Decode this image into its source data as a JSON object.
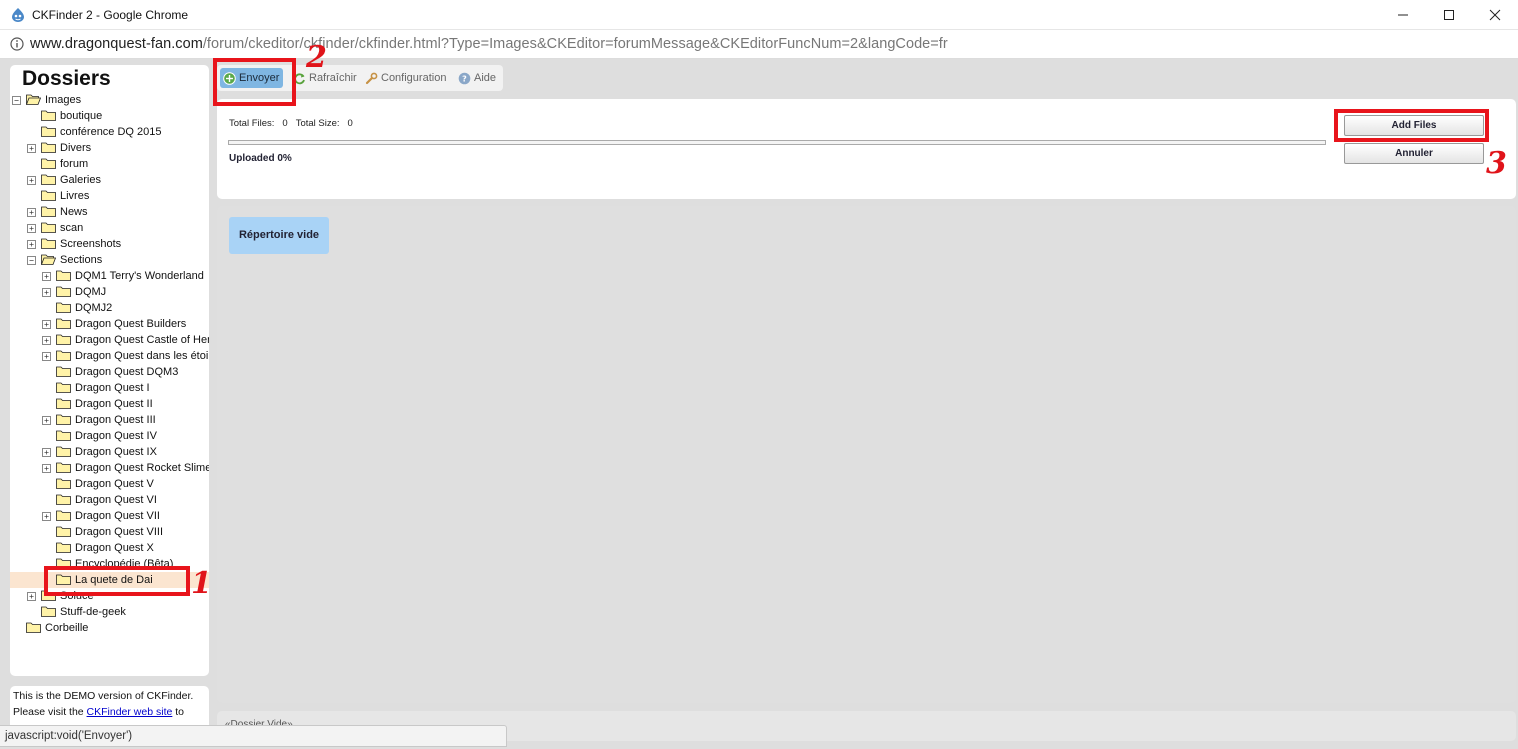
{
  "window": {
    "title": "CKFinder 2 - Google Chrome",
    "url_host": "www.dragonquest-fan.com",
    "url_rest": "/forum/ckeditor/ckfinder/ckfinder.html?Type=Images&CKEditor=forumMessage&CKEditorFuncNum=2&langCode=fr"
  },
  "sidebar": {
    "title": "Dossiers",
    "tree": [
      {
        "label": "Images",
        "level": 0,
        "expander": "−",
        "open": true
      },
      {
        "label": "boutique",
        "level": 1,
        "expander": ""
      },
      {
        "label": "conférence DQ 2015",
        "level": 1,
        "expander": ""
      },
      {
        "label": "Divers",
        "level": 1,
        "expander": "+"
      },
      {
        "label": "forum",
        "level": 1,
        "expander": ""
      },
      {
        "label": "Galeries",
        "level": 1,
        "expander": "+"
      },
      {
        "label": "Livres",
        "level": 1,
        "expander": ""
      },
      {
        "label": "News",
        "level": 1,
        "expander": "+"
      },
      {
        "label": "scan",
        "level": 1,
        "expander": "+"
      },
      {
        "label": "Screenshots",
        "level": 1,
        "expander": "+"
      },
      {
        "label": "Sections",
        "level": 1,
        "expander": "−",
        "open": true
      },
      {
        "label": "DQM1 Terry's Wonderland",
        "level": 2,
        "expander": "+"
      },
      {
        "label": "DQMJ",
        "level": 2,
        "expander": "+"
      },
      {
        "label": "DQMJ2",
        "level": 2,
        "expander": ""
      },
      {
        "label": "Dragon Quest Builders",
        "level": 2,
        "expander": "+"
      },
      {
        "label": "Dragon Quest Castle of Heroes",
        "level": 2,
        "expander": "+"
      },
      {
        "label": "Dragon Quest dans les étoiles",
        "level": 2,
        "expander": "+"
      },
      {
        "label": "Dragon Quest DQM3",
        "level": 2,
        "expander": ""
      },
      {
        "label": "Dragon Quest I",
        "level": 2,
        "expander": ""
      },
      {
        "label": "Dragon Quest II",
        "level": 2,
        "expander": ""
      },
      {
        "label": "Dragon Quest III",
        "level": 2,
        "expander": "+"
      },
      {
        "label": "Dragon Quest IV",
        "level": 2,
        "expander": ""
      },
      {
        "label": "Dragon Quest IX",
        "level": 2,
        "expander": "+"
      },
      {
        "label": "Dragon Quest Rocket Slime",
        "level": 2,
        "expander": "+"
      },
      {
        "label": "Dragon Quest V",
        "level": 2,
        "expander": ""
      },
      {
        "label": "Dragon Quest VI",
        "level": 2,
        "expander": ""
      },
      {
        "label": "Dragon Quest VII",
        "level": 2,
        "expander": "+"
      },
      {
        "label": "Dragon Quest VIII",
        "level": 2,
        "expander": ""
      },
      {
        "label": "Dragon Quest X",
        "level": 2,
        "expander": ""
      },
      {
        "label": "Encyclopédie (Bêta)",
        "level": 2,
        "expander": ""
      },
      {
        "label": "La quete de Dai",
        "level": 2,
        "expander": "",
        "selected": true
      },
      {
        "label": "Soluce",
        "level": 1,
        "expander": "+"
      },
      {
        "label": "Stuff-de-geek",
        "level": 1,
        "expander": ""
      },
      {
        "label": "Corbeille",
        "level": 0,
        "expander": ""
      }
    ],
    "demo_text_1": "This is the DEMO version of CKFinder.",
    "demo_text_2": "Please visit the ",
    "demo_link": "CKFinder web site",
    "demo_text_3": " to"
  },
  "toolbar": {
    "upload": "Envoyer",
    "refresh": "Rafraîchir",
    "settings": "Configuration",
    "help": "Aide"
  },
  "upload_panel": {
    "total_files_label": "Total Files:",
    "total_files_value": "0",
    "total_size_label": "Total Size:",
    "total_size_value": "0",
    "progress": 0,
    "uploaded_text": "Uploaded 0%",
    "add_files": "Add Files",
    "cancel": "Annuler"
  },
  "files": {
    "empty_message": "Répertoire vide"
  },
  "statusbar": {
    "text": "«Dossier Vide»"
  },
  "browser_status": "javascript:void('Envoyer')",
  "annotations": {
    "n1": "1",
    "n2": "2",
    "n3": "3"
  },
  "colors": {
    "accent": "#7fb6e2",
    "annotation": "#e8141b",
    "selection": "#fbe5d0"
  }
}
